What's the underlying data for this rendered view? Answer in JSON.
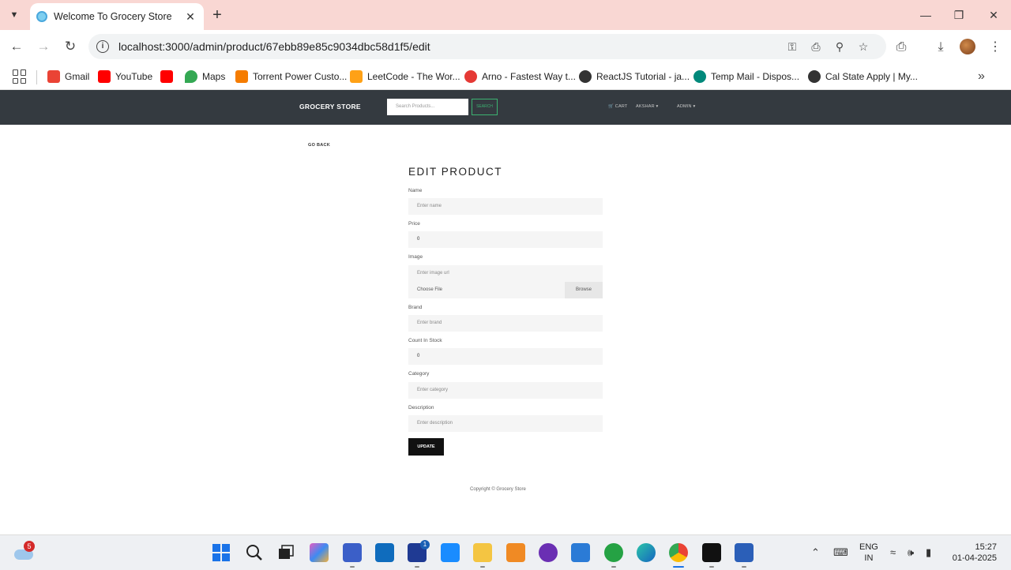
{
  "browser": {
    "tab_title": "Welcome To Grocery Store",
    "url": "localhost:3000/admin/product/67ebb89e85c9034dbc58d1f5/edit",
    "bookmarks": [
      {
        "label": "Gmail",
        "color": "#ea4335"
      },
      {
        "label": "YouTube",
        "color": "#ff0000"
      },
      {
        "label": "",
        "color": "#ff0000"
      },
      {
        "label": "Maps",
        "color": "#34a853"
      },
      {
        "label": "Torrent Power Custo...",
        "color": "#f57c00"
      },
      {
        "label": "LeetCode - The Wor...",
        "color": "#ffa116"
      },
      {
        "label": "Arno - Fastest Way t...",
        "color": "#e53935"
      },
      {
        "label": "ReactJS Tutorial - ja...",
        "color": "#333333"
      },
      {
        "label": "Temp Mail - Dispos...",
        "color": "#00897b"
      },
      {
        "label": "Cal State Apply | My...",
        "color": "#333333"
      }
    ]
  },
  "site": {
    "brand": "GROCERY STORE",
    "search_placeholder": "Search Products...",
    "search_button": "SEARCH",
    "cart": "CART",
    "user": "AKSHAR",
    "admin": "ADMIN"
  },
  "page": {
    "go_back": "GO BACK",
    "title": "EDIT PRODUCT",
    "fields": {
      "name": {
        "label": "Name",
        "placeholder": "Enter name"
      },
      "price": {
        "label": "Price",
        "value": "0"
      },
      "image": {
        "label": "Image",
        "placeholder": "Enter image url",
        "file_label": "Choose File",
        "browse": "Browse"
      },
      "brand": {
        "label": "Brand",
        "placeholder": "Enter brand"
      },
      "count": {
        "label": "Count In Stock",
        "value": "0"
      },
      "category": {
        "label": "Category",
        "placeholder": "Enter category"
      },
      "description": {
        "label": "Description",
        "placeholder": "Enter description"
      }
    },
    "update_button": "UPDATE",
    "footer": "Copyright © Grocery Store"
  },
  "taskbar": {
    "weather_badge": "5",
    "outlook_badge": "1",
    "lang_line1": "ENG",
    "lang_line2": "IN",
    "time": "15:27",
    "date": "01-04-2025"
  }
}
